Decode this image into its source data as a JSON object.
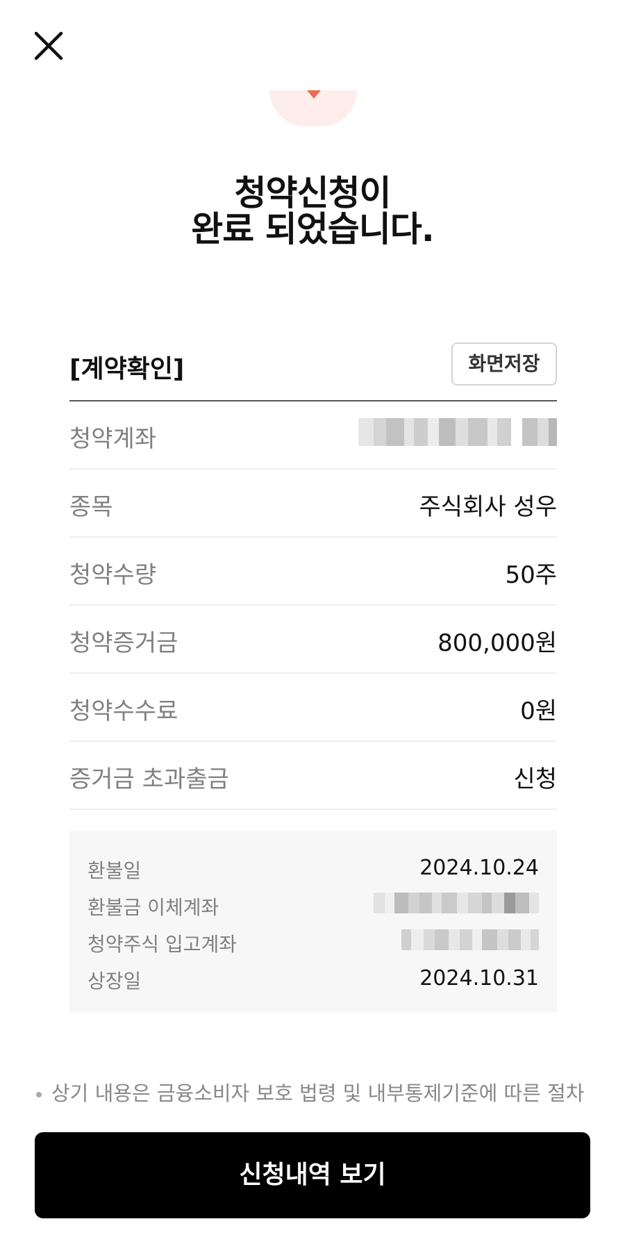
{
  "header": {
    "close_icon": "close-icon"
  },
  "title": {
    "line1": "청약신청이",
    "line2": "완료 되었습니다."
  },
  "card": {
    "title": "[계약확인]",
    "save_button": "화면저장",
    "rows": [
      {
        "label": "청약계좌",
        "value": ""
      },
      {
        "label": "종목",
        "value": "주식회사 성우"
      },
      {
        "label": "청약수량",
        "value": "50주"
      },
      {
        "label": "청약증거금",
        "value": "800,000원"
      },
      {
        "label": "청약수수료",
        "value": "0원"
      },
      {
        "label": "증거금 초과출금",
        "value": "신청"
      }
    ]
  },
  "info": {
    "rows": [
      {
        "label": "환불일",
        "value": "2024.10.24"
      },
      {
        "label": "환불금 이체계좌",
        "value": ""
      },
      {
        "label": "청약주식 입고계좌",
        "value": ""
      },
      {
        "label": "상장일",
        "value": "2024.10.31"
      }
    ]
  },
  "notice": "상기 내용은 금융소비자 보호 법령 및 내부통제기준에 따른 절차",
  "cta": {
    "label": "신청내역 보기"
  },
  "colors": {
    "accent": "#ee6a56",
    "cta_bg": "#000000"
  }
}
